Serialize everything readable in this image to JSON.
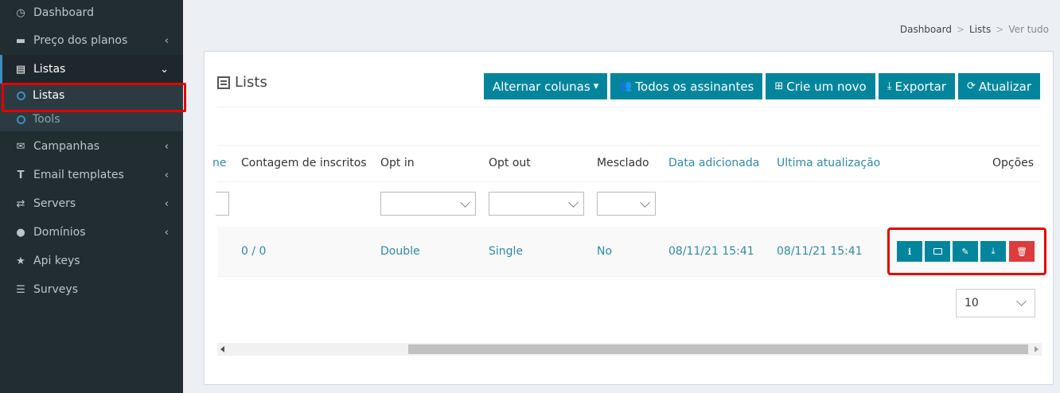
{
  "sidebar": {
    "items": [
      {
        "label": "Dashboard",
        "icon": "dashboard-icon"
      },
      {
        "label": "Preço dos planos",
        "icon": "credit-card-icon"
      },
      {
        "label": "Listas",
        "icon": "list-icon"
      },
      {
        "label": "Campanhas",
        "icon": "envelope-icon"
      },
      {
        "label": "Email templates",
        "icon": "text-icon"
      },
      {
        "label": "Servers",
        "icon": "exchange-icon"
      },
      {
        "label": "Domínios",
        "icon": "globe-icon"
      },
      {
        "label": "Api keys",
        "icon": "star-icon"
      },
      {
        "label": "Surveys",
        "icon": "list-ul-icon"
      }
    ],
    "submenu": [
      {
        "label": "Listas"
      },
      {
        "label": "Tools"
      }
    ]
  },
  "breadcrumb": [
    "Dashboard",
    "Lists",
    "Ver tudo"
  ],
  "box": {
    "title": "Lists",
    "toolbar": {
      "toggle_columns": "Alternar colunas",
      "all_subscribers": "Todos os assinantes",
      "create_new": "Crie um novo",
      "export": "Exportar",
      "refresh": "Atualizar"
    }
  },
  "table": {
    "columns": [
      "ne",
      "Contagem de inscritos",
      "Opt in",
      "Opt out",
      "Mesclado",
      "Data adicionada",
      "Ultima atualização",
      "Opções"
    ],
    "rows": [
      {
        "subscribers": "0 / 0",
        "opt_in": "Double",
        "opt_out": "Single",
        "merged": "No",
        "date_added": "08/11/21 15:41",
        "last_updated": "08/11/21 15:41"
      }
    ],
    "page_size": "10"
  },
  "colors": {
    "accent": "#00859c",
    "danger": "#dd3c3c",
    "sidebar": "#222d32",
    "highlight": "#e30000"
  }
}
